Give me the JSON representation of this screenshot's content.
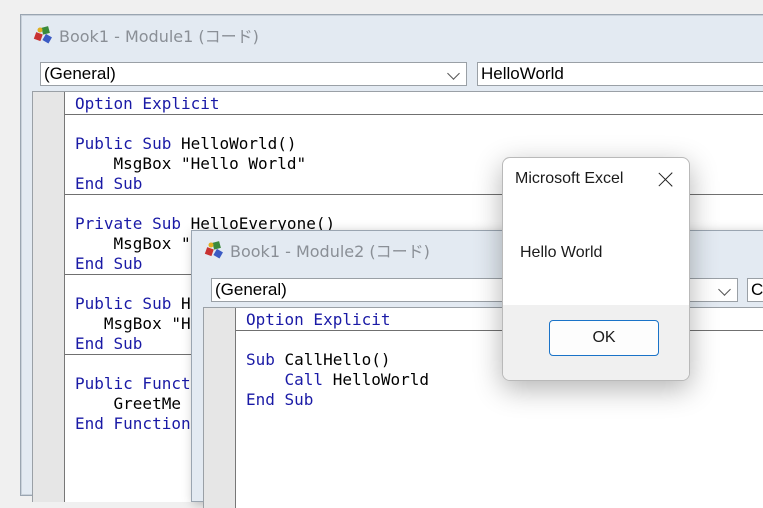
{
  "window1": {
    "title": "Book1 - Module1 (コード)",
    "object_combo": "(General)",
    "procedure_combo": "HelloWorld",
    "code": [
      {
        "kw": "Option Explicit",
        "rest": ""
      },
      {
        "kw": "Public Sub",
        "rest": " HelloWorld()"
      },
      {
        "kw": "",
        "rest": "    MsgBox \"Hello World\""
      },
      {
        "kw": "End Sub",
        "rest": ""
      },
      {
        "kw": "Private Sub",
        "rest": " HelloEveryone()"
      },
      {
        "kw": "",
        "rest": "    MsgBox \""
      },
      {
        "kw": "End Sub",
        "rest": ""
      },
      {
        "kw": "Public Sub",
        "rest": " H"
      },
      {
        "kw": "",
        "rest": "   MsgBox \"H"
      },
      {
        "kw": "End Sub",
        "rest": ""
      },
      {
        "kw": "Public Funct",
        "rest": ""
      },
      {
        "kw": "",
        "rest": "    GreetMe"
      },
      {
        "kw": "End Function",
        "rest": ""
      }
    ]
  },
  "window2": {
    "title": "Book1 - Module2 (コード)",
    "object_combo": "(General)",
    "procedure_combo": "C",
    "code": [
      {
        "kw": "Option Explicit",
        "rest": ""
      },
      {
        "kw": "Sub",
        "rest": " CallHello()"
      },
      {
        "kw": "    Call",
        "rest": " HelloWorld"
      },
      {
        "kw": "End Sub",
        "rest": ""
      }
    ]
  },
  "msgbox": {
    "title": "Microsoft Excel",
    "message": "Hello World",
    "ok_label": "OK"
  },
  "colors": {
    "keyword": "#1a1aa6",
    "ok_border": "#1a73c8"
  }
}
